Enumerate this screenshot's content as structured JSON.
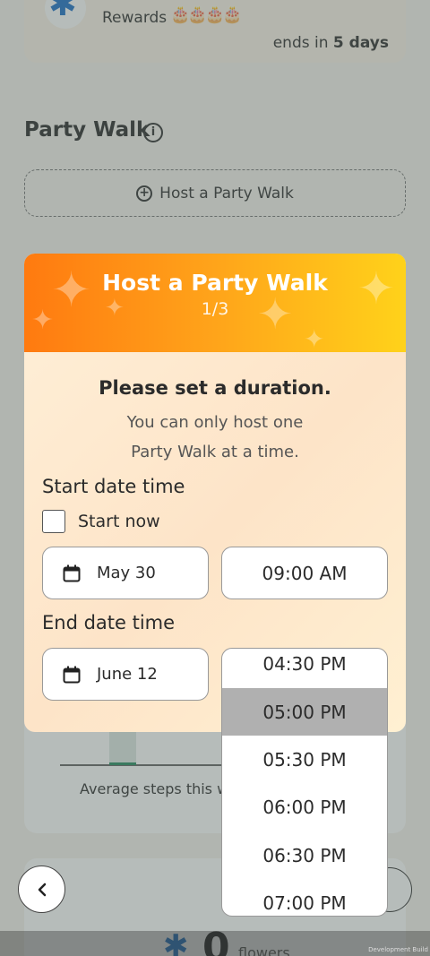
{
  "background": {
    "rewards_label": "Rewards",
    "ends_prefix": "ends in",
    "ends_value": "5 days",
    "section_title": "Party Walk",
    "host_button_label": "Host a Party Walk",
    "avg_steps_label": "Average steps this w",
    "flowers_count": "0",
    "flowers_word": "flowers",
    "dev_build_label": "Development Build"
  },
  "modal": {
    "title": "Host a Party Walk",
    "step": "1/3",
    "heading": "Please set a duration.",
    "subtitle_line1": "You can only host one",
    "subtitle_line2": "Party Walk at a time.",
    "start_label": "Start date time",
    "start_now_label": "Start now",
    "start_date": "May 30",
    "start_time": "09:00 AM",
    "end_label": "End date time",
    "end_date": "June 12"
  },
  "time_dropdown": {
    "options": [
      "04:30 PM",
      "05:00 PM",
      "05:30 PM",
      "06:00 PM",
      "06:30 PM",
      "07:00 PM"
    ],
    "selected": "05:00 PM"
  },
  "colors": {
    "header_gradient_start": "#ff7a10",
    "header_gradient_end": "#ffd21a",
    "selected_option": "#b0b0b0",
    "flower_blue": "#1f73c9"
  }
}
